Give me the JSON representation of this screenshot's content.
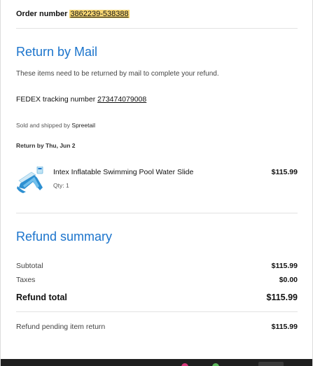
{
  "order": {
    "label": "Order number",
    "number": "3862239-538388"
  },
  "return_section": {
    "title": "Return by Mail",
    "description": "These items need to be returned by mail to complete your refund.",
    "tracking_label": "FEDEX tracking number",
    "tracking_number": "273474079008",
    "sold_by_label": "Sold and shipped by",
    "sold_by_value": "Spreetail",
    "return_by": "Return by Thu, Jun 2"
  },
  "item": {
    "name": "Intex Inflatable Swimming Pool Water Slide",
    "qty": "Qty: 1",
    "price": "$115.99",
    "image_icon": "water-slide-product-image"
  },
  "refund_summary": {
    "title": "Refund summary",
    "subtotal_label": "Subtotal",
    "subtotal_value": "$115.99",
    "taxes_label": "Taxes",
    "taxes_value": "$0.00",
    "total_label": "Refund total",
    "total_value": "$115.99",
    "pending_label": "Refund pending item return",
    "pending_value": "$115.99"
  },
  "colors": {
    "accent_blue": "#1b74cc",
    "highlight": "#f7d774",
    "taskbar": "#1f1f1f"
  }
}
